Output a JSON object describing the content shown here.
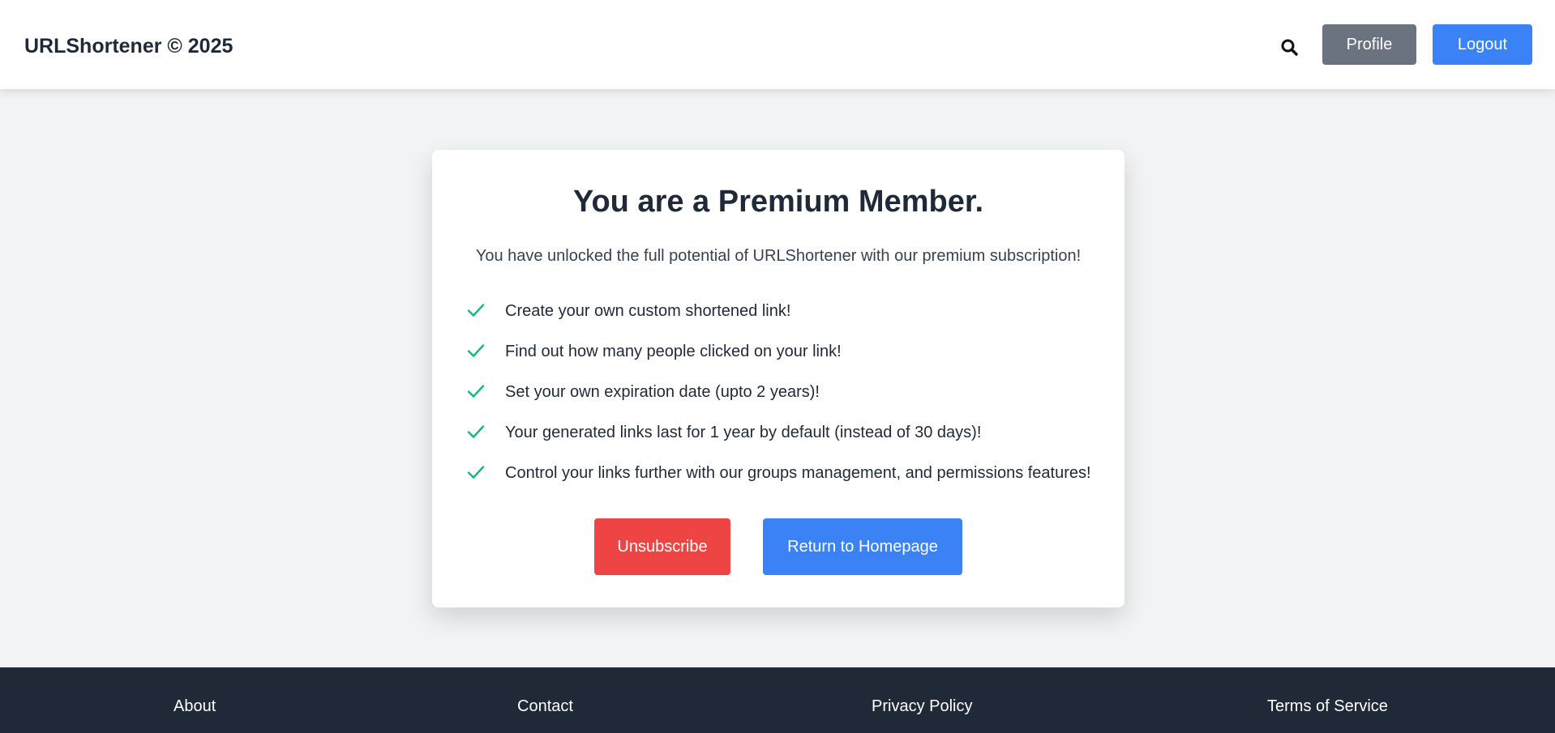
{
  "header": {
    "brand": "URLShortener © 2025",
    "search_icon": "search-icon",
    "profile_label": "Profile",
    "logout_label": "Logout"
  },
  "card": {
    "title": "You are a Premium Member.",
    "subtitle": "You have unlocked the full potential of URLShortener with our premium subscription!",
    "features": [
      {
        "icon": "check-icon",
        "text": "Create your own custom shortened link!"
      },
      {
        "icon": "check-icon",
        "text": "Find out how many people clicked on your link!"
      },
      {
        "icon": "check-icon",
        "text": "Set your own expiration date (upto 2 years)!"
      },
      {
        "icon": "check-icon",
        "text": "Your generated links last for 1 year by default (instead of 30 days)!"
      },
      {
        "icon": "check-icon",
        "text": "Control your links further with our groups management, and permissions features!"
      }
    ],
    "unsubscribe_label": "Unsubscribe",
    "home_label": "Return to Homepage"
  },
  "footer": {
    "links": [
      "About",
      "Contact",
      "Privacy Policy",
      "Terms of Service"
    ]
  },
  "colors": {
    "page_background": "#f2f3f5",
    "profile_button": "#6b7280",
    "primary_blue": "#3b82f6",
    "danger_red": "#ef4444",
    "check_green": "#10b981",
    "footer_background": "#1f2937"
  }
}
